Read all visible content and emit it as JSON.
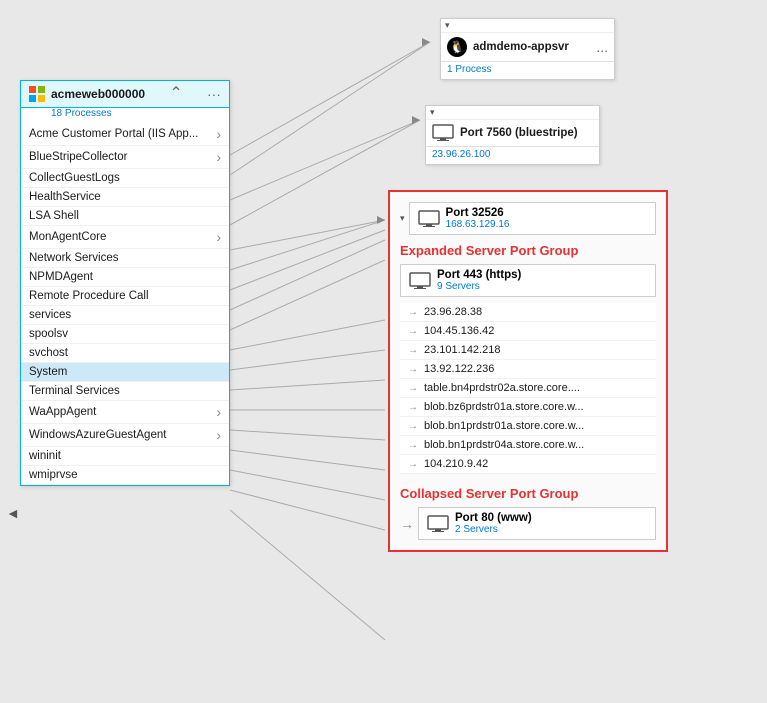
{
  "leftPanel": {
    "title": "acmeweb000000",
    "subtitle": "18 Processes",
    "items": [
      {
        "label": "Acme Customer Portal (IIS App...",
        "hasArrow": true
      },
      {
        "label": "BlueStripeCollector",
        "hasArrow": true
      },
      {
        "label": "CollectGuestLogs",
        "hasArrow": false
      },
      {
        "label": "HealthService",
        "hasArrow": false
      },
      {
        "label": "LSA Shell",
        "hasArrow": false
      },
      {
        "label": "MonAgentCore",
        "hasArrow": true
      },
      {
        "label": "Network Services",
        "hasArrow": false
      },
      {
        "label": "NPMDAgent",
        "hasArrow": false
      },
      {
        "label": "Remote Procedure Call",
        "hasArrow": false
      },
      {
        "label": "services",
        "hasArrow": false
      },
      {
        "label": "spoolsv",
        "hasArrow": false
      },
      {
        "label": "svchost",
        "hasArrow": false
      },
      {
        "label": "System",
        "hasArrow": false,
        "selected": true
      },
      {
        "label": "Terminal Services",
        "hasArrow": false
      },
      {
        "label": "WaAppAgent",
        "hasArrow": true
      },
      {
        "label": "WindowsAzureGuestAgent",
        "hasArrow": true
      },
      {
        "label": "wininit",
        "hasArrow": false
      },
      {
        "label": "wmiprvse",
        "hasArrow": false
      }
    ]
  },
  "appsvrNode": {
    "title": "admdemo-appsvr",
    "subtitle": "1 Process",
    "moreLabel": "..."
  },
  "port7560Node": {
    "title": "Port 7560 (bluestripe)",
    "subtitle": "23.96.26.100"
  },
  "port32526Node": {
    "title": "Port 32526",
    "subtitle": "168.63.129.16"
  },
  "expandedGroup": {
    "title": "Expanded Server Port Group",
    "portCard": {
      "title": "Port 443 (https)",
      "subtitle": "9 Servers"
    },
    "servers": [
      "23.96.28.38",
      "104.45.136.42",
      "23.101.142.218",
      "13.92.122.236",
      "table.bn4prdstr02a.store.core....",
      "blob.bz6prdstr01a.store.core.w...",
      "blob.bn1prdstr01a.store.core.w...",
      "blob.bn1prdstr04a.store.core.w...",
      "104.210.9.42"
    ]
  },
  "collapsedGroup": {
    "title": "Collapsed Server Port Group",
    "portCard": {
      "title": "Port 80 (www)",
      "subtitle": "2 Servers"
    }
  }
}
